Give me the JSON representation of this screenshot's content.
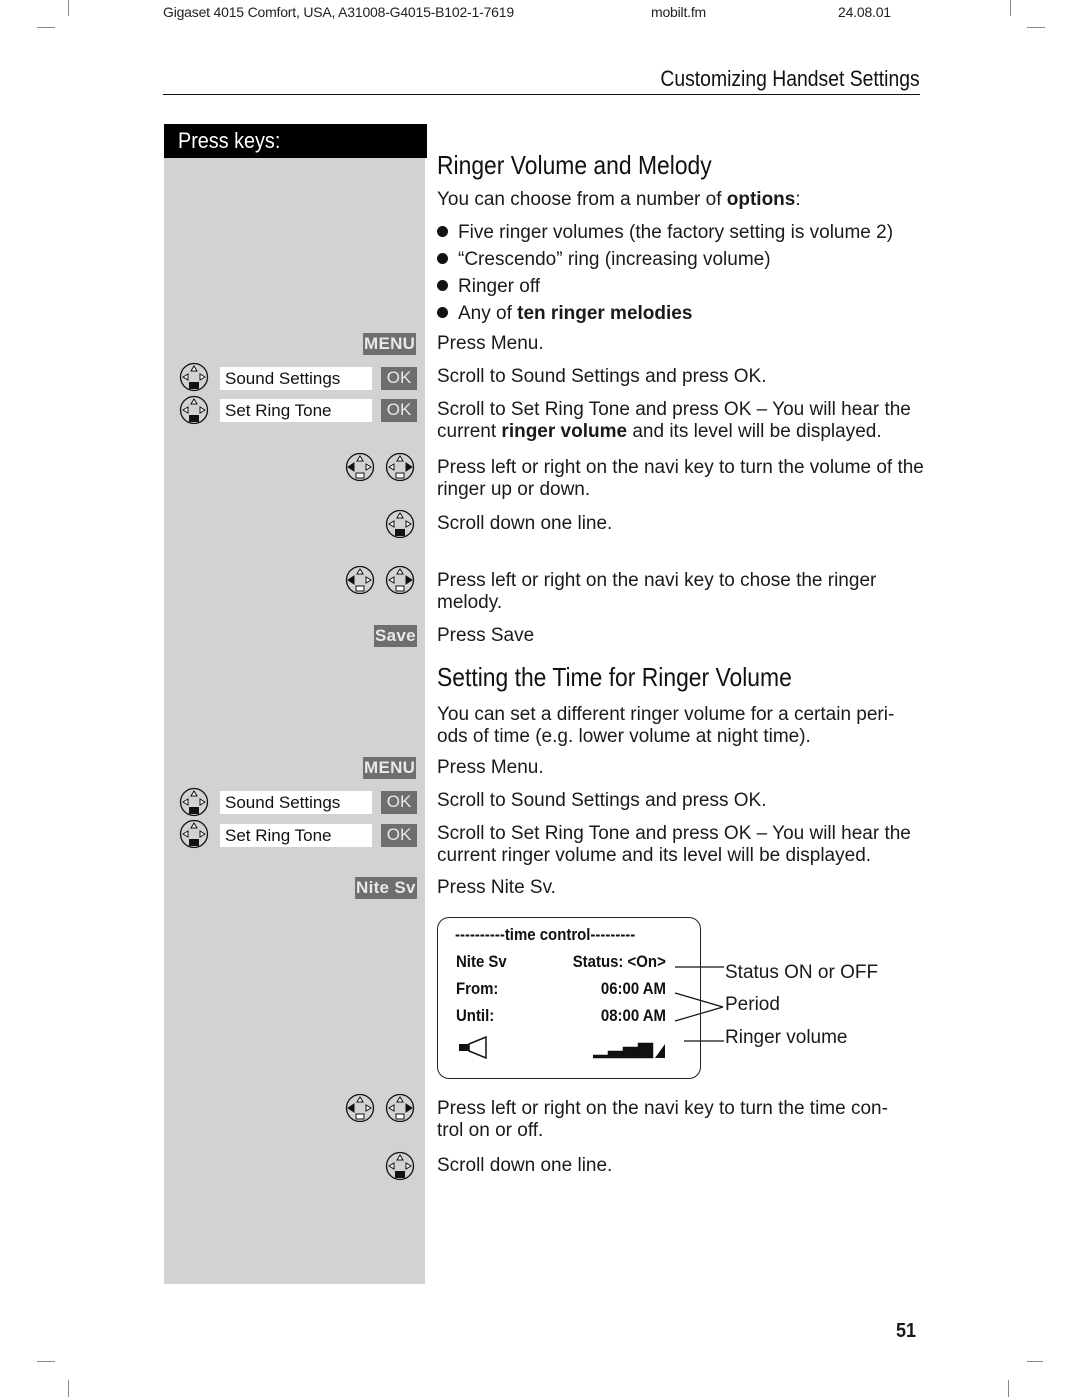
{
  "header": {
    "doc_id": "Gigaset 4015 Comfort, USA, A31008-G4015-B102-1-7619",
    "file": "mobilt.fm",
    "date": "24.08.01",
    "section": "Customizing Handset Settings"
  },
  "sidebar": {
    "title": "Press keys:"
  },
  "keys": {
    "menu": "MENU",
    "ok": "OK",
    "save": "Save",
    "nite_sv": "Nite Sv",
    "sound_settings": "Sound Settings",
    "set_ring_tone": "Set Ring Tone"
  },
  "section1": {
    "title": "Ringer Volume and Melody",
    "intro_pre": "You can choose from a number of ",
    "intro_bold": "options",
    "intro_post": ":",
    "bullets": [
      {
        "pre": "Five ringer volumes (the factory setting is volume 2)",
        "bold": ""
      },
      {
        "pre": "“Crescendo” ring (increasing volume)",
        "bold": ""
      },
      {
        "pre": "Ringer off",
        "bold": ""
      },
      {
        "pre": "Any of ",
        "bold": "ten ringer melodies"
      }
    ],
    "steps": {
      "press_menu": "Press Menu.",
      "scroll_sound": "Scroll to Sound Settings and press OK.",
      "scroll_ring_pre": "Scroll to Set Ring Tone and press OK – You will hear the current ",
      "scroll_ring_bold": "ringer volume",
      "scroll_ring_post": " and its level will be displayed.",
      "volume": "Press left or right on the navi key to turn the volume of the ringer up or down.",
      "scroll_down": "Scroll down one line.",
      "melody": "Press left or right on the navi key to chose the ringer melody.",
      "press_save": "Press Save"
    }
  },
  "section2": {
    "title": "Setting the Time for Ringer Volume",
    "intro": "You can set a different ringer volume for a certain peri-ods of time (e.g. lower volume at night time).",
    "intro_line1": "You can set a different ringer volume for a certain peri-",
    "intro_line2": "ods of time (e.g. lower volume at night time).",
    "steps": {
      "press_menu": "Press Menu.",
      "scroll_sound": "Scroll to Sound Settings and press OK.",
      "scroll_ring": "Scroll to Set Ring Tone and press OK – You will hear the current ringer volume and its level will be displayed.",
      "press_nite": "Press Nite Sv.",
      "toggle": "Press left or right on the navi key to turn the time con-trol on or off.",
      "toggle_line1": "Press left or right on the navi key to turn the time con-",
      "toggle_line2": "trol on or off.",
      "scroll_down": "Scroll down one line."
    }
  },
  "display": {
    "header": "----------time control---------",
    "nite_label": "Nite Sv",
    "status": "Status: <On>",
    "from_label": "From:",
    "from_value": "06:00 AM",
    "until_label": "Until:",
    "until_value": "08:00 AM",
    "volume_level": 4,
    "volume_max": 5
  },
  "annotations": {
    "status": "Status ON or OFF",
    "period": "Period",
    "volume": "Ringer volume"
  },
  "page_number": "51"
}
